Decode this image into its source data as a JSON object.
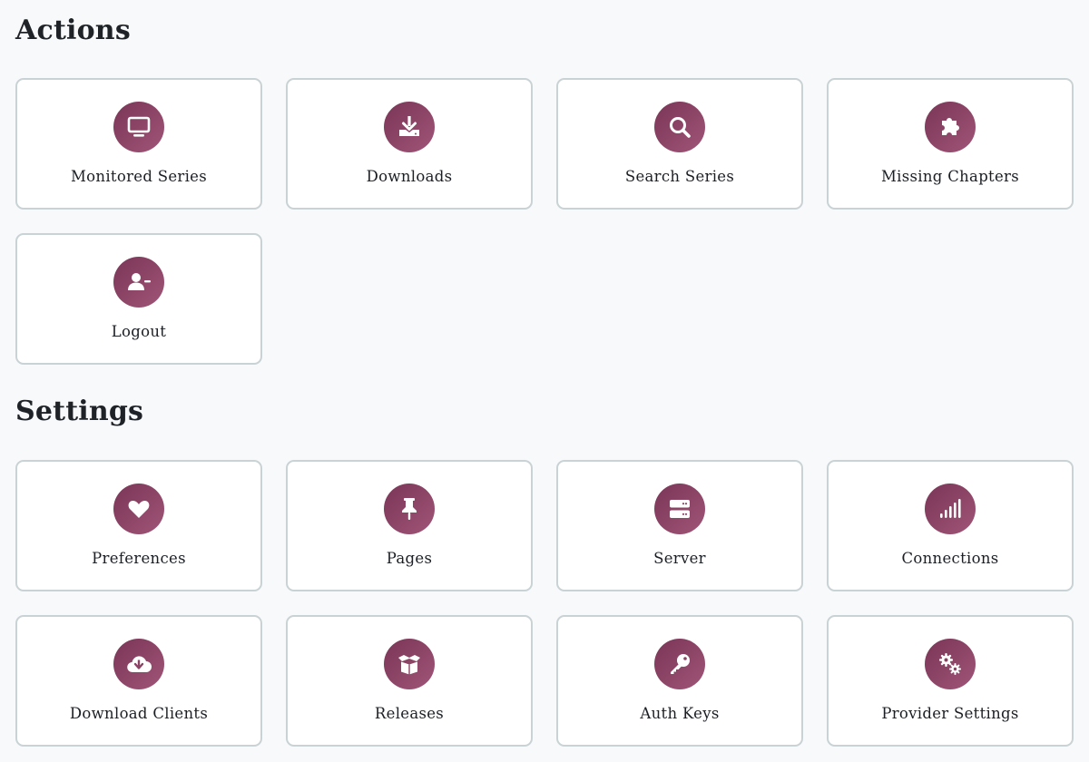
{
  "actions": {
    "title": "Actions",
    "cards": [
      {
        "label": "Monitored Series",
        "icon": "monitor-icon"
      },
      {
        "label": "Downloads",
        "icon": "download-icon"
      },
      {
        "label": "Search Series",
        "icon": "search-icon"
      },
      {
        "label": "Missing Chapters",
        "icon": "puzzle-icon"
      },
      {
        "label": "Logout",
        "icon": "user-minus-icon"
      }
    ]
  },
  "settings": {
    "title": "Settings",
    "cards": [
      {
        "label": "Preferences",
        "icon": "heart-icon"
      },
      {
        "label": "Pages",
        "icon": "thumbtack-icon"
      },
      {
        "label": "Server",
        "icon": "server-icon"
      },
      {
        "label": "Connections",
        "icon": "signal-icon"
      },
      {
        "label": "Download Clients",
        "icon": "cloud-download-icon"
      },
      {
        "label": "Releases",
        "icon": "box-open-icon"
      },
      {
        "label": "Auth Keys",
        "icon": "key-icon"
      },
      {
        "label": "Provider Settings",
        "icon": "gears-icon"
      }
    ]
  },
  "colors": {
    "accent": "#8b4264",
    "card_border": "#c9d2d4",
    "background": "#f8f9fb"
  }
}
